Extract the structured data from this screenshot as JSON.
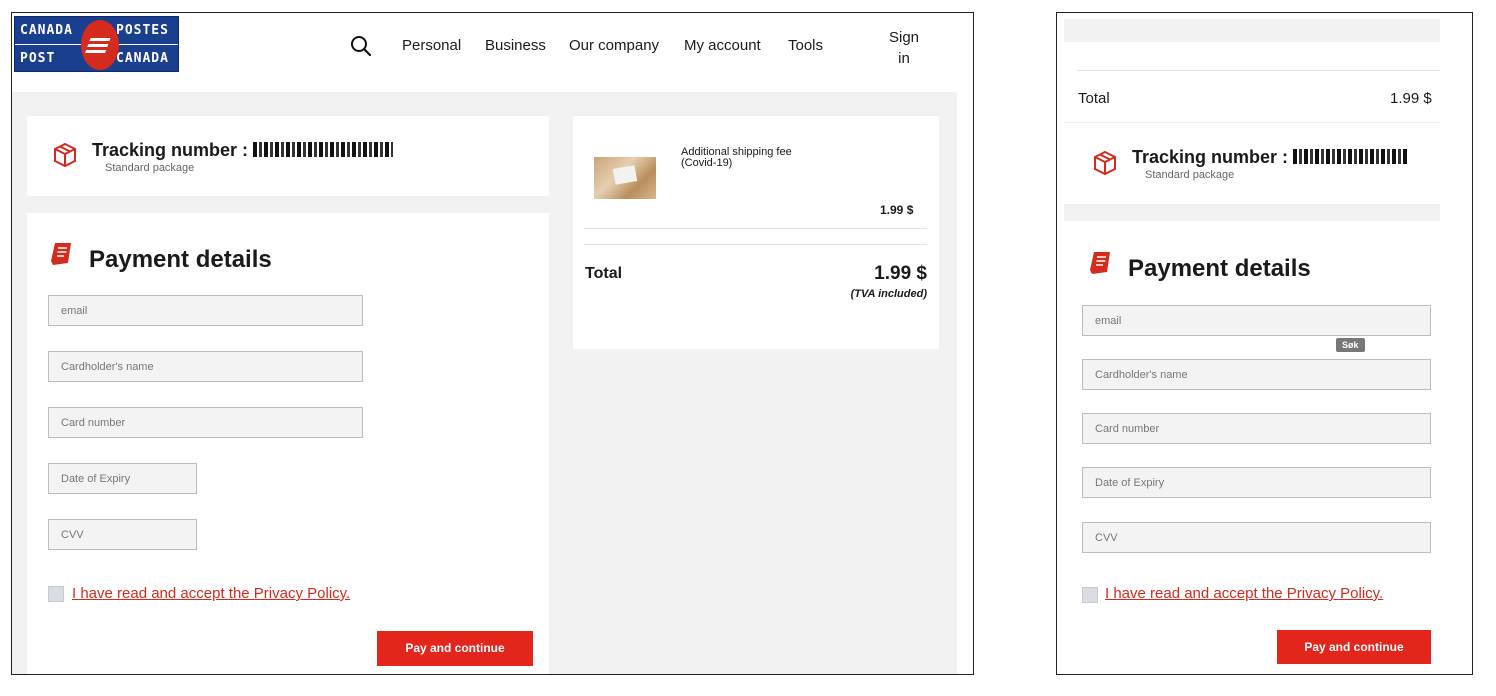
{
  "brand": {
    "logo_words": [
      "CANADA",
      "POSTES",
      "POST",
      "CANADA"
    ],
    "accent_color": "#e3261c",
    "logo_blue": "#1a3f8f"
  },
  "nav": {
    "search_icon": "search-icon",
    "items": [
      "Personal",
      "Business",
      "Our company",
      "My account",
      "Tools"
    ],
    "signin_line1": "Sign",
    "signin_line2": "in"
  },
  "tracking": {
    "label": "Tracking number :",
    "package_type": "Standard package",
    "icon": "package-box-icon"
  },
  "payment": {
    "title": "Payment details",
    "icon": "receipt-icon",
    "fields": {
      "email": "email",
      "cardholder": "Cardholder's name",
      "card_number": "Card number",
      "expiry": "Date of Expiry",
      "cvv": "CVV"
    },
    "policy_text": "I have read and accept the Privacy Policy.",
    "pay_button": "Pay and continue"
  },
  "summary": {
    "item_name": "Additional shipping fee",
    "item_name2": "(Covid-19)",
    "item_price": "1.99 $",
    "total_label": "Total",
    "total_value": "1.99 $",
    "tax_note": "(TVA included)"
  },
  "mobile": {
    "total_label": "Total",
    "total_value": "1.99 $",
    "tooltip": "Søk"
  }
}
